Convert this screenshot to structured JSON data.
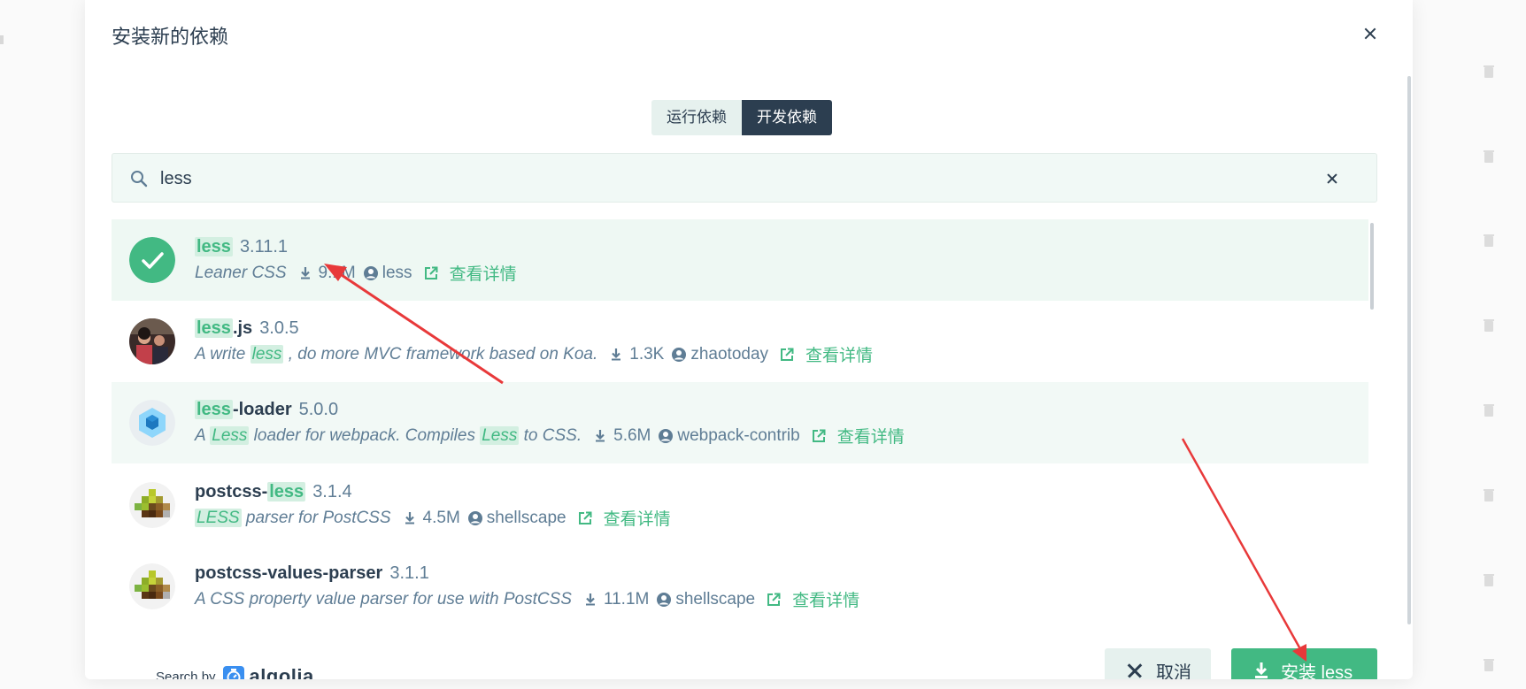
{
  "dialog": {
    "title": "安装新的依赖",
    "tabs": [
      {
        "label": "运行依赖",
        "active": false
      },
      {
        "label": "开发依赖",
        "active": true
      }
    ],
    "search": {
      "value": "less"
    }
  },
  "results": [
    {
      "name_parts": [
        {
          "text": "less",
          "hl": true
        }
      ],
      "version": "3.11.1",
      "description_parts": [
        {
          "text": "Leaner CSS",
          "hl": false
        }
      ],
      "downloads": "9.1M",
      "author": "less",
      "details_label": "查看详情",
      "selected": true
    },
    {
      "name_parts": [
        {
          "text": "less",
          "hl": true
        },
        {
          "text": ".js",
          "hl": false
        }
      ],
      "version": "3.0.5",
      "description_parts": [
        {
          "text": "A write ",
          "hl": false
        },
        {
          "text": "less",
          "hl": true
        },
        {
          "text": " , do more MVC framework based on Koa.",
          "hl": false
        }
      ],
      "downloads": "1.3K",
      "author": "zhaotoday",
      "details_label": "查看详情"
    },
    {
      "name_parts": [
        {
          "text": "less",
          "hl": true
        },
        {
          "text": "-loader",
          "hl": false
        }
      ],
      "version": "5.0.0",
      "description_parts": [
        {
          "text": "A ",
          "hl": false
        },
        {
          "text": "Less",
          "hl": true
        },
        {
          "text": "  loader for webpack. Compiles ",
          "hl": false
        },
        {
          "text": "Less",
          "hl": true
        },
        {
          "text": " to CSS.",
          "hl": false
        }
      ],
      "downloads": "5.6M",
      "author": "webpack-contrib",
      "details_label": "查看详情",
      "hovered": true
    },
    {
      "name_parts": [
        {
          "text": "postcss-",
          "hl": false
        },
        {
          "text": "less",
          "hl": true
        }
      ],
      "version": "3.1.4",
      "description_parts": [
        {
          "text": "LESS",
          "hl": true
        },
        {
          "text": "  parser for PostCSS",
          "hl": false
        }
      ],
      "downloads": "4.5M",
      "author": "shellscape",
      "details_label": "查看详情"
    },
    {
      "name_parts": [
        {
          "text": "postcss-values-parser",
          "hl": false
        }
      ],
      "version": "3.1.1",
      "description_parts": [
        {
          "text": "A CSS property value parser for use with PostCSS",
          "hl": false
        }
      ],
      "downloads": "11.1M",
      "author": "shellscape",
      "details_label": "查看详情"
    }
  ],
  "footer": {
    "search_by_label": "Search by",
    "algolia_label": "algolia",
    "cancel_label": "取消",
    "install_label": "安装 less"
  },
  "colors": {
    "accent": "#42b983",
    "dark": "#2c3e50",
    "annotation_arrow": "#e8393a"
  }
}
